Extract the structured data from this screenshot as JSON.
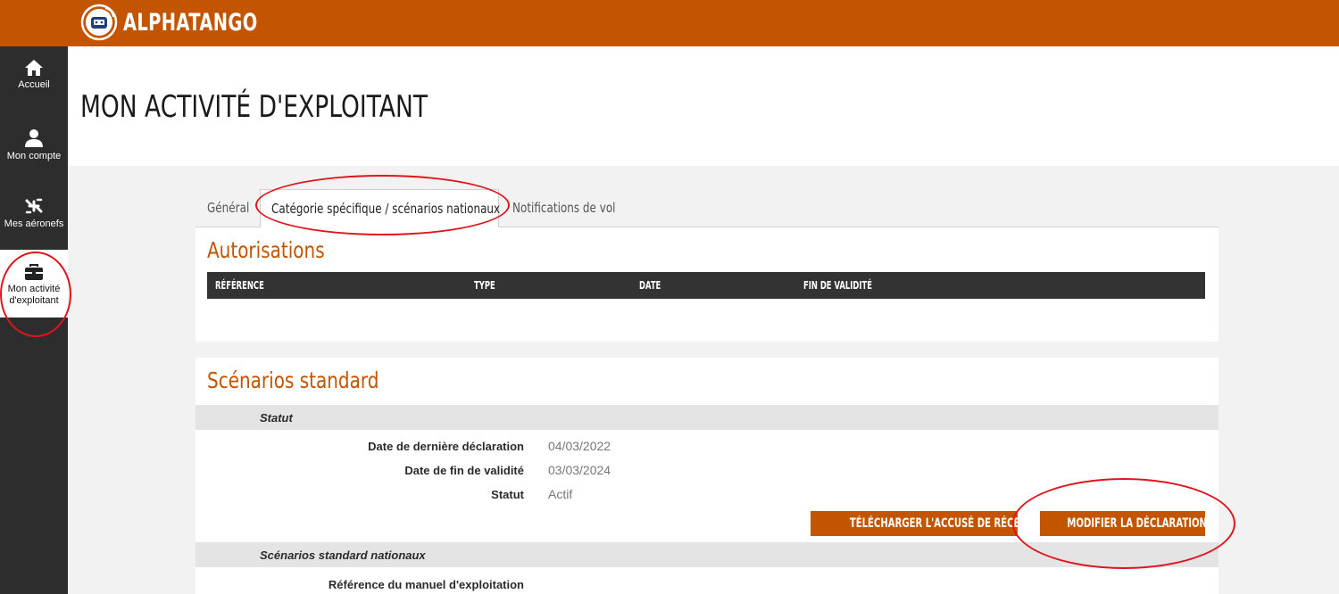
{
  "header": {
    "brand": "ALPHATANGO"
  },
  "sidebar": {
    "items": [
      {
        "label": "Accueil",
        "icon": "home-icon"
      },
      {
        "label": "Mon compte",
        "icon": "user-icon"
      },
      {
        "label": "Mes aéronefs",
        "icon": "drone-icon"
      },
      {
        "label": "Mon activité d'exploitant",
        "label_line1": "Mon activité",
        "label_line2": "d'exploitant",
        "icon": "briefcase-icon",
        "active": true
      }
    ]
  },
  "page": {
    "title": "MON ACTIVITÉ D'EXPLOITANT"
  },
  "tabs": [
    {
      "label": "Général",
      "active": false
    },
    {
      "label": "Catégorie spécifique / scénarios nationaux",
      "active": true
    },
    {
      "label": "Notifications de vol",
      "active": false
    }
  ],
  "autorisations": {
    "title": "Autorisations",
    "columns": [
      "RÉFÉRENCE",
      "TYPE",
      "DATE",
      "FIN DE VALIDITÉ"
    ],
    "rows": []
  },
  "scenarios": {
    "title": "Scénarios standard",
    "statut_section": "Statut",
    "fields": [
      {
        "label": "Date de dernière déclaration",
        "value": "04/03/2022"
      },
      {
        "label": "Date de fin de validité",
        "value": "03/03/2024"
      },
      {
        "label": "Statut",
        "value": "Actif"
      }
    ],
    "buttons": {
      "download": "TÉLÉCHARGER L'ACCUSÉ DE RÉCEPTION",
      "modify": "MODIFIER LA DÉCLARATION"
    },
    "nationaux_section": "Scénarios standard nationaux",
    "manual_label": "Référence du manuel d'exploitation"
  },
  "colors": {
    "brand": "#c45500",
    "sidebar": "#2d2d2d",
    "table_header": "#333333",
    "annotation": "#e0151b"
  }
}
